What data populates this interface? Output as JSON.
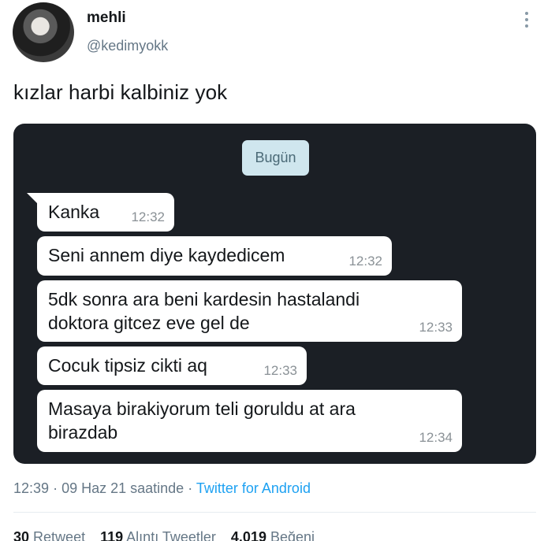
{
  "tweet": {
    "display_name": "mehli",
    "handle": "@kedimyokk",
    "text": "kızlar harbi kalbiniz yok"
  },
  "chat": {
    "date_chip": "Bugün",
    "messages": [
      {
        "text": "Kanka",
        "time": "12:32"
      },
      {
        "text": "Seni annem diye kaydedicem",
        "time": "12:32"
      },
      {
        "text": "5dk sonra ara beni kardesin hastalandi doktora gitcez eve gel de",
        "time": "12:33"
      },
      {
        "text": "Cocuk tipsiz cikti aq",
        "time": "12:33"
      },
      {
        "text": "Masaya birakiyorum teli goruldu at ara birazdab",
        "time": "12:34"
      }
    ]
  },
  "meta": {
    "time": "12:39",
    "date": "09 Haz 21 saatinde",
    "separator": "·",
    "source": "Twitter for Android"
  },
  "stats": {
    "retweets_count": "30",
    "retweets_label": "Retweet",
    "quotes_count": "119",
    "quotes_label": "Alıntı Tweetler",
    "likes_count": "4.019",
    "likes_label": "Beğeni"
  },
  "icons": {
    "more": "more-vertical-icon"
  }
}
